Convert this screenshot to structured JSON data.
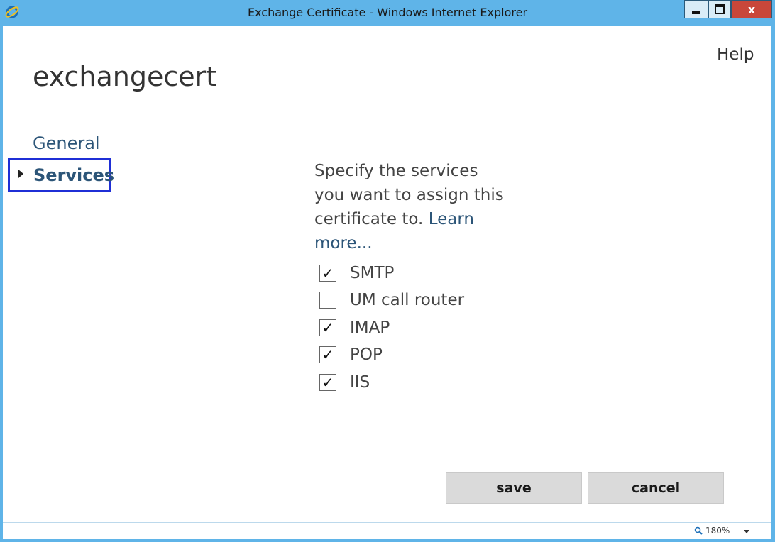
{
  "window": {
    "title": "Exchange Certificate - Windows Internet Explorer",
    "close_label": "x"
  },
  "header": {
    "help_label": "Help",
    "page_title": "exchangecert"
  },
  "nav": {
    "items": [
      {
        "label": "General"
      },
      {
        "label": "Services",
        "selected": true
      }
    ]
  },
  "main": {
    "description": "Specify the services you want to assign this certificate to.",
    "learn_more": "Learn more...",
    "services": [
      {
        "label": "SMTP",
        "checked": true,
        "mark": "✓"
      },
      {
        "label": "UM call router",
        "checked": false,
        "mark": ""
      },
      {
        "label": "IMAP",
        "checked": true,
        "mark": "✓"
      },
      {
        "label": "POP",
        "checked": true,
        "mark": "✓"
      },
      {
        "label": "IIS",
        "checked": true,
        "mark": "✓"
      }
    ]
  },
  "buttons": {
    "save_label": "save",
    "cancel_label": "cancel"
  },
  "statusbar": {
    "zoom_level": "180%"
  },
  "colors": {
    "titlebar": "#5fb4e8",
    "link": "#2c5578",
    "selection_border": "#1f2fd6",
    "close_button": "#c9473a"
  }
}
